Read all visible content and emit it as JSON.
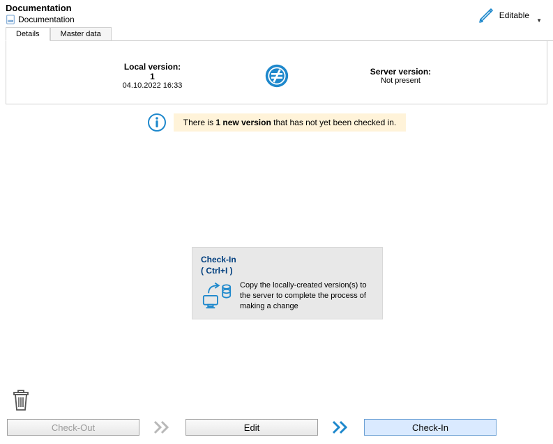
{
  "header": {
    "title": "Documentation",
    "subtitle": "Documentation",
    "editable_label": "Editable"
  },
  "tabs": {
    "details": "Details",
    "master_data": "Master data"
  },
  "versions": {
    "local_label": "Local version:",
    "local_num": "1",
    "local_date": "04.10.2022 16:33",
    "server_label": "Server version:",
    "server_value": "Not present"
  },
  "info": {
    "prefix": "There is ",
    "bold": "1 new version",
    "suffix": " that has not yet been checked in."
  },
  "tooltip": {
    "title_line1": "Check-In",
    "title_line2": "( Ctrl+I )",
    "desc": "Copy the locally-created version(s) to the server to complete the process of making a change"
  },
  "buttons": {
    "check_out": "Check-Out",
    "edit": "Edit",
    "check_in": "Check-In"
  }
}
